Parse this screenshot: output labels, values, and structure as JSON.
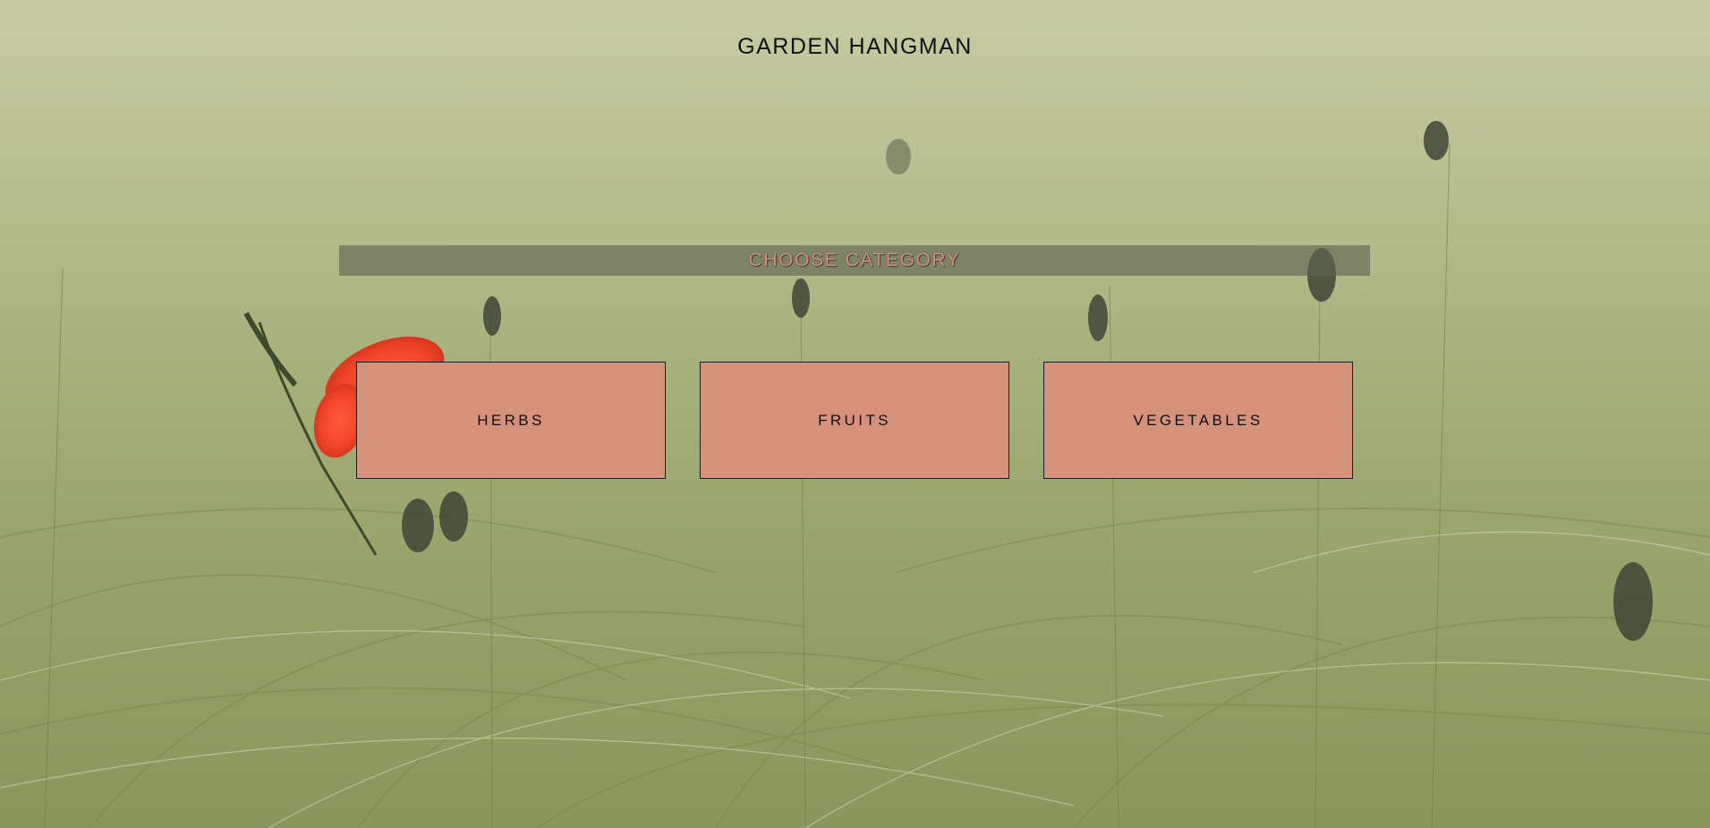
{
  "page": {
    "title": "GARDEN HANGMAN"
  },
  "category": {
    "heading": "CHOOSE CATEGORY",
    "buttons": [
      {
        "label": "HERBS"
      },
      {
        "label": "FRUITS"
      },
      {
        "label": "VEGETABLES"
      }
    ]
  },
  "theme": {
    "button_color": "#d59179",
    "heading_color": "#d6907a",
    "bar_color": "#5f6252",
    "background": "grass-field-photo"
  }
}
